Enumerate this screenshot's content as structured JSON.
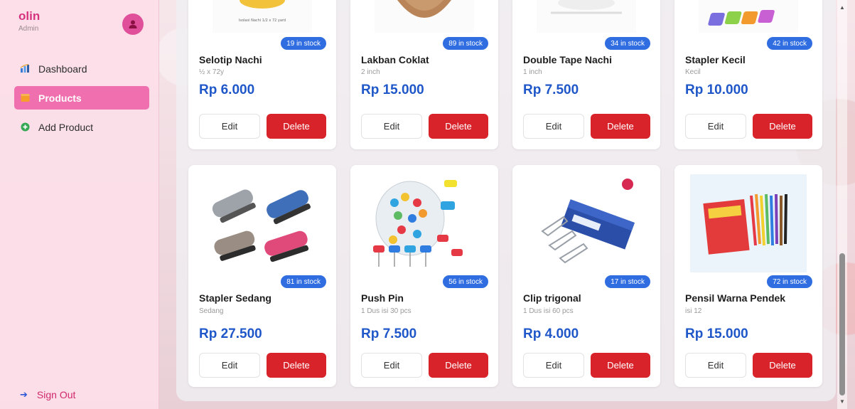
{
  "sidebar": {
    "brand": "olin",
    "role": "Admin",
    "items": [
      {
        "label": "Dashboard"
      },
      {
        "label": "Products"
      },
      {
        "label": "Add Product"
      }
    ],
    "signout": "Sign Out"
  },
  "products": [
    {
      "name": "Selotip Nachi",
      "desc": "½ x 72y",
      "price": "Rp 6.000",
      "stock": "19 in stock",
      "edit": "Edit",
      "delete": "Delete",
      "img_caption": "Isolasi Nachi 1/2 x 72 yard"
    },
    {
      "name": "Lakban Coklat",
      "desc": "2 inch",
      "price": "Rp 15.000",
      "stock": "89 in stock",
      "edit": "Edit",
      "delete": "Delete"
    },
    {
      "name": "Double Tape Nachi",
      "desc": "1 inch",
      "price": "Rp 7.500",
      "stock": "34 in stock",
      "edit": "Edit",
      "delete": "Delete"
    },
    {
      "name": "Stapler Kecil",
      "desc": "Kecil",
      "price": "Rp 10.000",
      "stock": "42 in stock",
      "edit": "Edit",
      "delete": "Delete"
    },
    {
      "name": "Stapler Sedang",
      "desc": "Sedang",
      "price": "Rp 27.500",
      "stock": "81 in stock",
      "edit": "Edit",
      "delete": "Delete"
    },
    {
      "name": "Push Pin",
      "desc": "1 Dus isi 30 pcs",
      "price": "Rp 7.500",
      "stock": "56 in stock",
      "edit": "Edit",
      "delete": "Delete"
    },
    {
      "name": "Clip trigonal",
      "desc": "1 Dus isi 60 pcs",
      "price": "Rp 4.000",
      "stock": "17 in stock",
      "edit": "Edit",
      "delete": "Delete"
    },
    {
      "name": "Pensil Warna Pendek",
      "desc": "isi 12",
      "price": "Rp 15.000",
      "stock": "72 in stock",
      "edit": "Edit",
      "delete": "Delete"
    }
  ],
  "colors": {
    "brand": "#d6337e",
    "active_nav": "#f06faf",
    "price": "#1f57c9",
    "stock_badge": "#2f6de0",
    "delete_button": "#d9232b"
  },
  "icons": [
    "user-avatar-icon",
    "dashboard-chart-icon",
    "products-box-icon",
    "plus-circle-icon",
    "sign-out-arrow-icon"
  ]
}
